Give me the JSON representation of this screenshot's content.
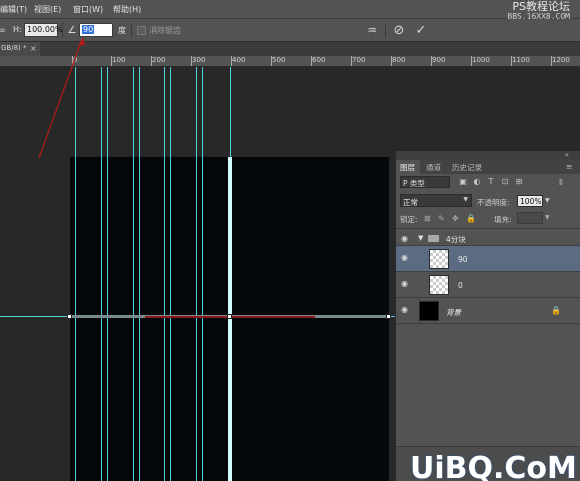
{
  "menubar": {
    "items": [
      "编辑(T)",
      "视图(E)",
      "窗口(W)",
      "帮助(H)"
    ]
  },
  "watermark": {
    "line1": "PS教程论坛",
    "line2": "BBS.16XX8.COM"
  },
  "options": {
    "h_label": "H:",
    "h_value": "100.00%",
    "angle_value": "90",
    "angle_unit": "度",
    "antialias_label": "消除锯齿"
  },
  "tab": {
    "label": "GB/8) *",
    "close": "×"
  },
  "ruler": {
    "labels": [
      "0",
      "100",
      "200",
      "300",
      "400",
      "500",
      "600",
      "700",
      "800",
      "900",
      "1000",
      "1100",
      "1200"
    ]
  },
  "layers_panel": {
    "tabs": [
      "图层",
      "通道",
      "历史记录"
    ],
    "filter_label": "P 类型",
    "blend_mode": "正常",
    "opacity_label": "不透明度:",
    "opacity_value": "100%",
    "lock_label": "锁定:",
    "fill_label": "填充:",
    "fill_value": "100%",
    "layers": [
      {
        "name": "4分块",
        "type": "group"
      },
      {
        "name": "90",
        "type": "layer"
      },
      {
        "name": "0",
        "type": "layer"
      },
      {
        "name": "背景",
        "type": "background"
      }
    ]
  },
  "logo": {
    "text": "UiBQ.CoM"
  }
}
